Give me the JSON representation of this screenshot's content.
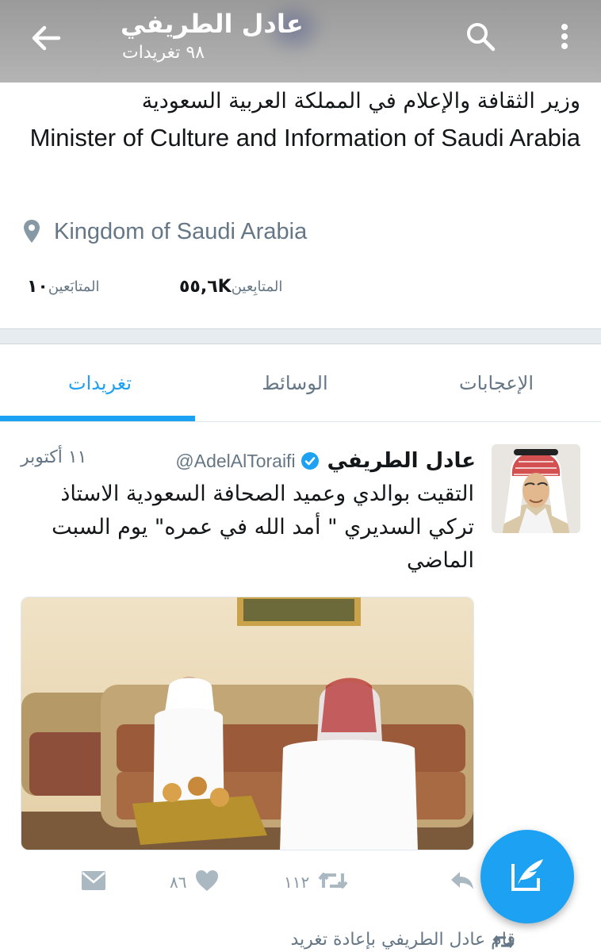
{
  "header": {
    "name": "عادل الطريفي",
    "tweet_count": "٩٨ تغريدات"
  },
  "profile": {
    "bio_ar": "وزير الثقافة والإعلام في المملكة العربية السعودية",
    "bio_en": "Minister of Culture and Information of Saudi Arabia",
    "location": "Kingdom of Saudi Arabia",
    "followers_count": "٥٥,٦K",
    "followers_label": "المتابِعين",
    "following_count": "١٠",
    "following_label": "المتابَعين"
  },
  "tabs": [
    {
      "label": "الإعجابات",
      "active": false
    },
    {
      "label": "الوسائط",
      "active": false
    },
    {
      "label": "تغريدات",
      "active": true
    }
  ],
  "tweet": {
    "name": "عادل الطريفي",
    "handle": "@AdelAlToraifi",
    "date": "١١ أكتوبر",
    "text": "التقيت بوالدي وعميد الصحافة السعودية الاستاذ تركي السديري \" أمد الله في عمره\" يوم السبت الماضي",
    "retweets": "١١٢",
    "likes": "٨٦"
  },
  "next_item": {
    "retweeted_by": "قام عادل الطريفي بإعادة تغريد"
  },
  "colors": {
    "accent": "#1da1f2",
    "muted": "#657786",
    "verified": "#1da1f2"
  },
  "icons": {
    "back": "arrow-left-icon",
    "search": "search-icon",
    "more": "more-vertical-icon",
    "location": "map-pin-icon",
    "verified": "verified-badge-icon",
    "reply": "reply-icon",
    "retweet": "retweet-icon",
    "like": "heart-icon",
    "dm": "envelope-icon",
    "compose": "compose-tweet-icon"
  }
}
